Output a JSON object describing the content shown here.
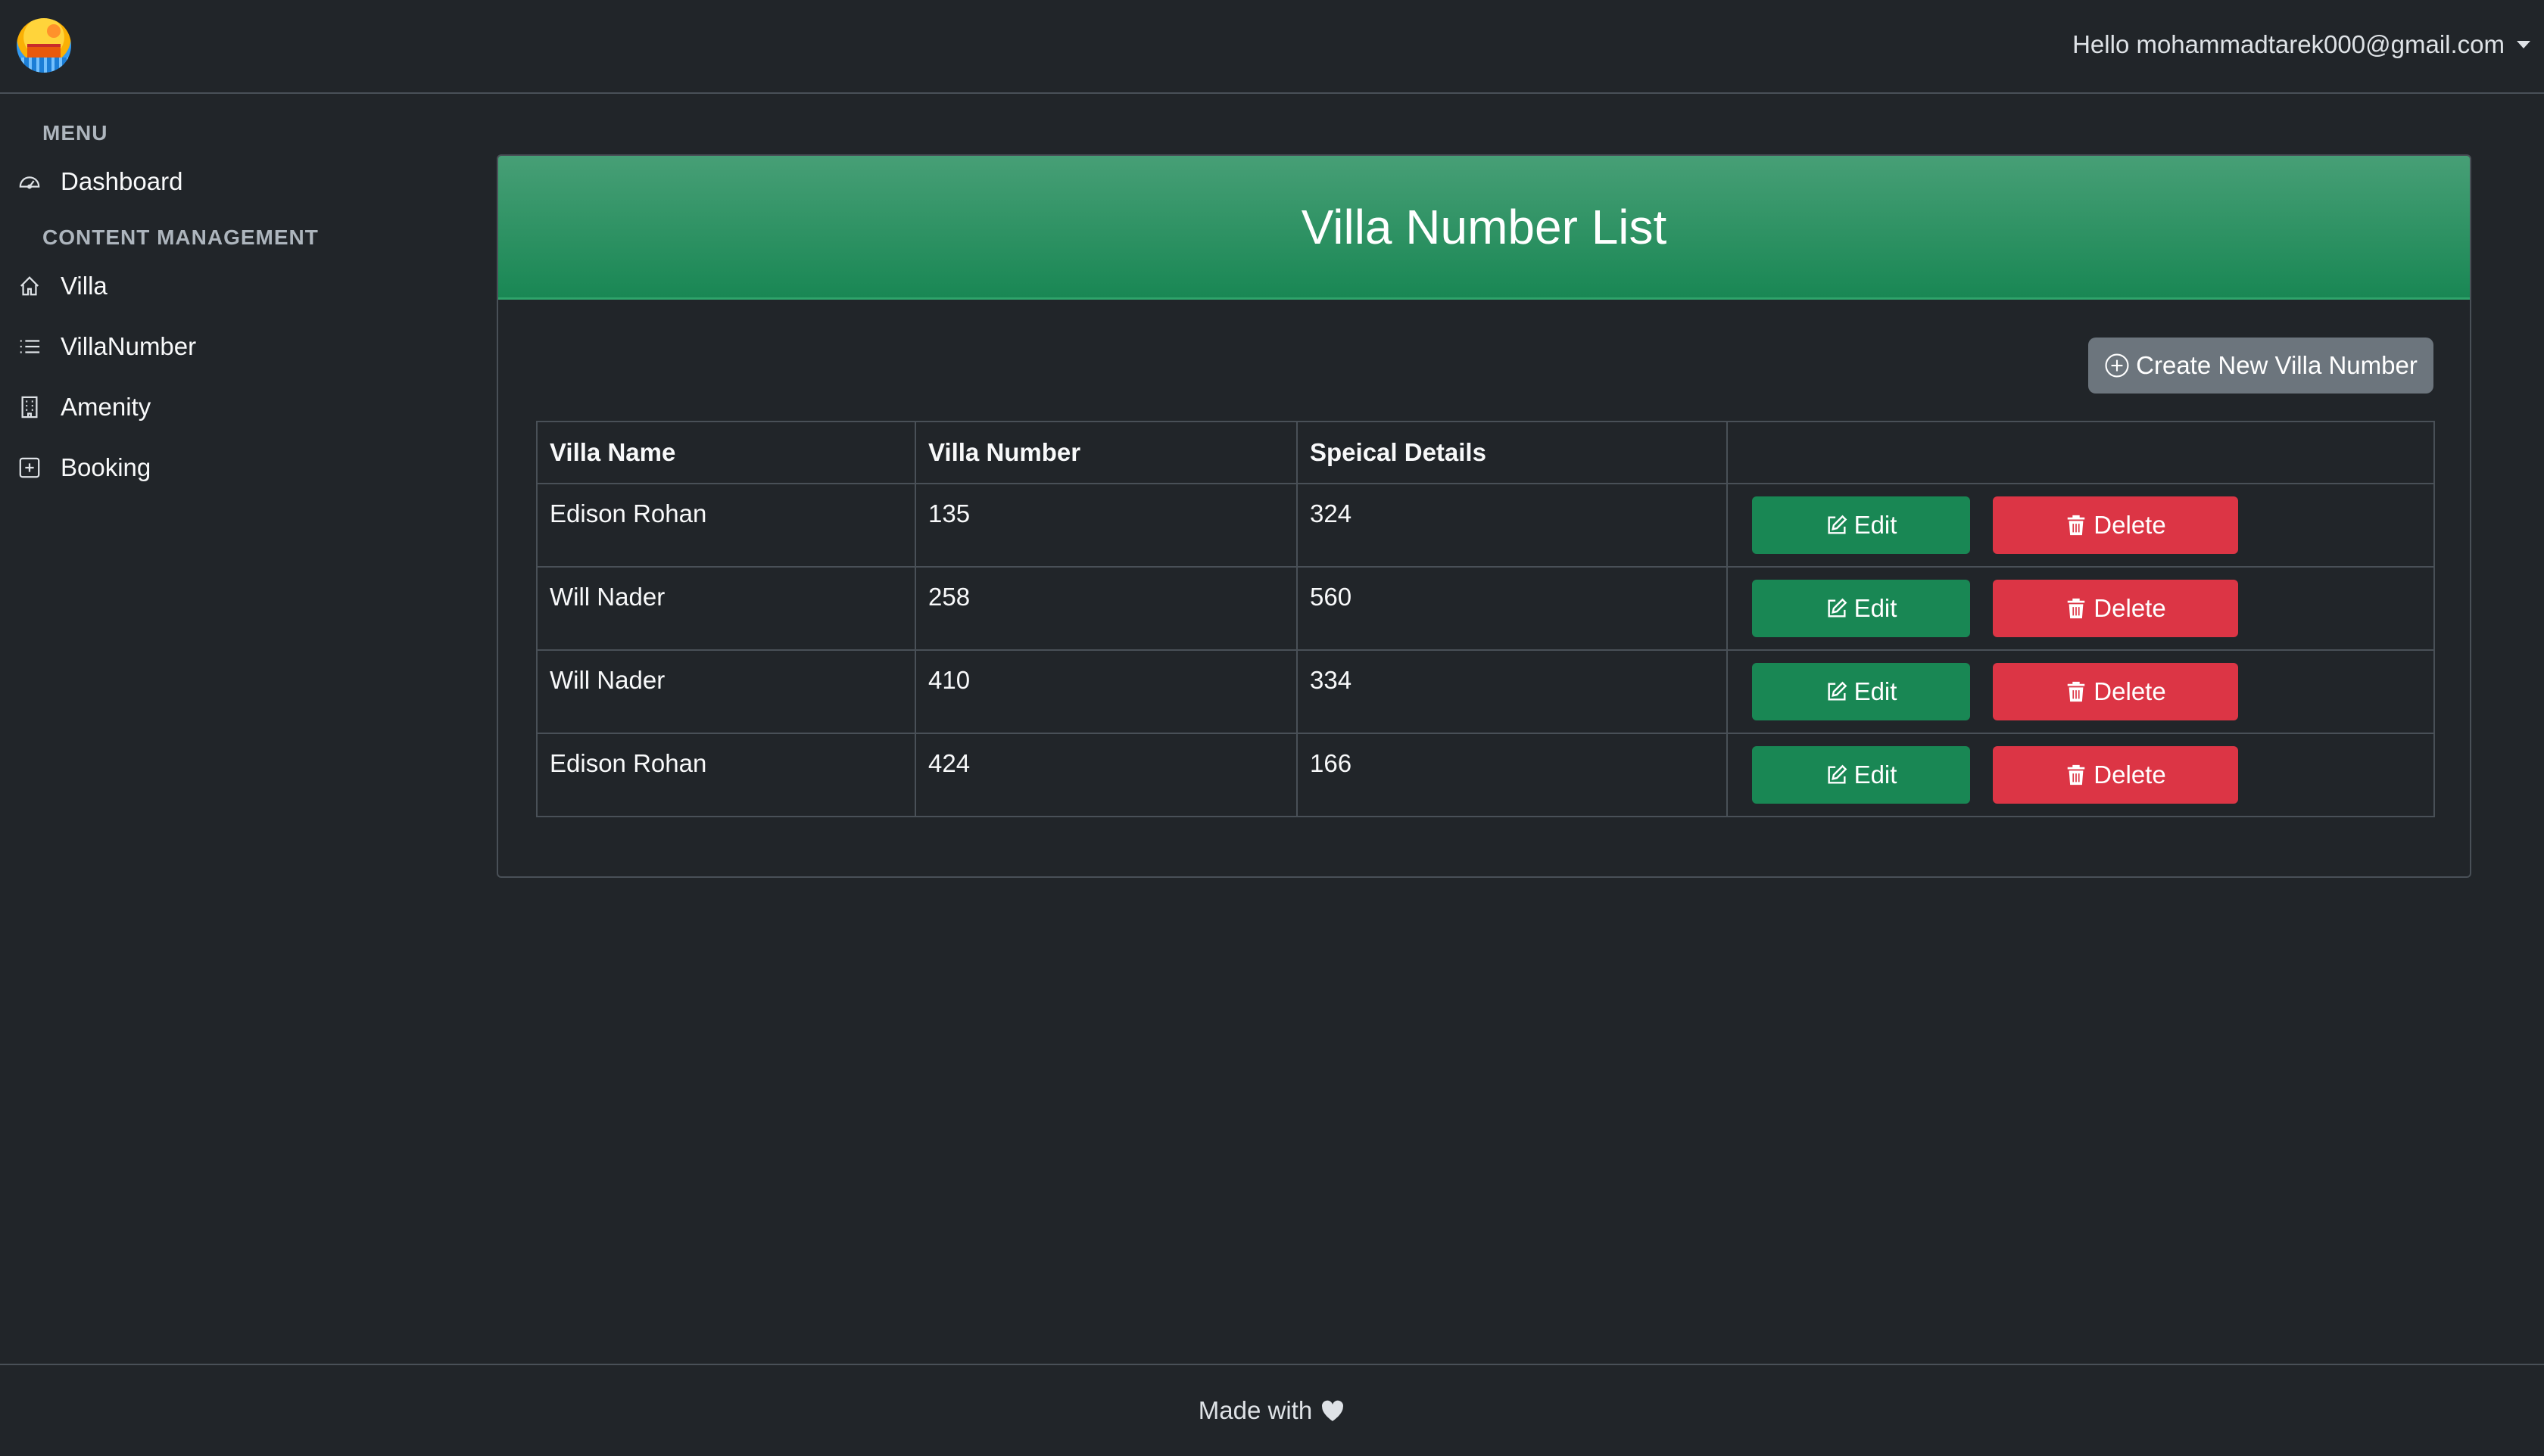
{
  "navbar": {
    "logo_alt": "logo",
    "user_greeting": "Hello mohammadtarek000@gmail.com"
  },
  "sidebar": {
    "menu_heading": "MENU",
    "content_heading": "CONTENT MANAGEMENT",
    "items": [
      {
        "label": "Dashboard",
        "icon": "speedometer-icon"
      },
      {
        "label": "Villa",
        "icon": "house-icon"
      },
      {
        "label": "VillaNumber",
        "icon": "list-icon"
      },
      {
        "label": "Amenity",
        "icon": "building-icon"
      },
      {
        "label": "Booking",
        "icon": "plus-square-icon"
      }
    ]
  },
  "card": {
    "title": "Villa Number List",
    "create_button": "Create New Villa Number"
  },
  "table": {
    "headers": [
      "Villa Name",
      "Villa Number",
      "Speical Details",
      ""
    ],
    "rows": [
      {
        "villa_name": "Edison Rohan",
        "villa_number": "135",
        "details": "324"
      },
      {
        "villa_name": "Will Nader",
        "villa_number": "258",
        "details": "560"
      },
      {
        "villa_name": "Will Nader",
        "villa_number": "410",
        "details": "334"
      },
      {
        "villa_name": "Edison Rohan",
        "villa_number": "424",
        "details": "166"
      }
    ],
    "edit_label": "Edit",
    "delete_label": "Delete"
  },
  "footer": {
    "text": "Made with"
  },
  "colors": {
    "background": "#212529",
    "header_green": "#198754",
    "edit_green": "#198754",
    "delete_red": "#dc3545",
    "secondary_gray": "#6c757d"
  }
}
